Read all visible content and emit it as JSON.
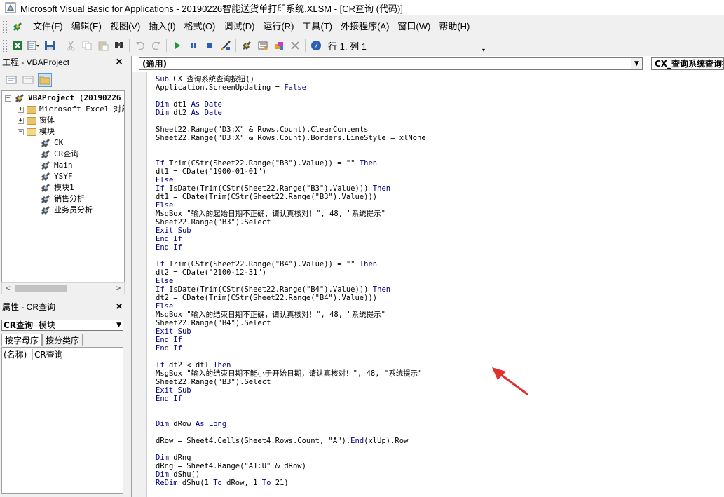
{
  "window": {
    "title": "Microsoft Visual Basic for Applications - 20190226智能送货单打印系统.XLSM - [CR查询 (代码)]"
  },
  "menu": {
    "items": [
      "文件(F)",
      "编辑(E)",
      "视图(V)",
      "插入(I)",
      "格式(O)",
      "调试(D)",
      "运行(R)",
      "工具(T)",
      "外接程序(A)",
      "窗口(W)",
      "帮助(H)"
    ]
  },
  "toolbar": {
    "position_text": "行 1, 列 1",
    "icons": [
      "excel-view-icon",
      "insert-module-icon",
      "save-icon",
      "cut-icon",
      "copy-icon",
      "paste-icon",
      "find-icon",
      "undo-icon",
      "redo-icon",
      "run-icon",
      "break-icon",
      "reset-icon",
      "design-mode-icon",
      "project-explorer-icon",
      "properties-icon",
      "object-browser-icon",
      "toolbox-icon",
      "help-icon"
    ]
  },
  "project_panel": {
    "title": "工程 - VBAProject",
    "close": "×",
    "tree": {
      "root": "VBAProject (20190226",
      "folders": [
        "Microsoft Excel 对象",
        "窗体",
        "模块"
      ],
      "modules": [
        "CK",
        "CR查询",
        "Main",
        "YSYF",
        "模块1",
        "销售分析",
        "业务员分析"
      ]
    }
  },
  "properties_panel": {
    "title": "属性 - CR查询",
    "close": "×",
    "object_name": "CR查询",
    "object_type": "模块",
    "tabs": [
      "按字母序",
      "按分类序"
    ],
    "rows": [
      {
        "name": "(名称)",
        "value": "CR查询"
      }
    ]
  },
  "code_window": {
    "object_combo": "(通用)",
    "proc_combo": "CX_查询系统查询按钮",
    "lines": [
      "Sub CX_查询系统查询按钮()",
      "Application.ScreenUpdating = False",
      "",
      "Dim dt1 As Date",
      "Dim dt2 As Date",
      "",
      "Sheet22.Range(\"D3:X\" & Rows.Count).ClearContents",
      "Sheet22.Range(\"D3:X\" & Rows.Count).Borders.LineStyle = xlNone",
      "",
      "",
      "If Trim(CStr(Sheet22.Range(\"B3\").Value)) = \"\" Then",
      "dt1 = CDate(\"1900-01-01\")",
      "Else",
      "If IsDate(Trim(CStr(Sheet22.Range(\"B3\").Value))) Then",
      "dt1 = CDate(Trim(CStr(Sheet22.Range(\"B3\").Value)))",
      "Else",
      "MsgBox \"输入的起始日期不正确，请认真核对！\", 48, \"系统提示\"",
      "Sheet22.Range(\"B3\").Select",
      "Exit Sub",
      "End If",
      "End If",
      "",
      "If Trim(CStr(Sheet22.Range(\"B4\").Value)) = \"\" Then",
      "dt2 = CDate(\"2100-12-31\")",
      "Else",
      "If IsDate(Trim(CStr(Sheet22.Range(\"B4\").Value))) Then",
      "dt2 = CDate(Trim(CStr(Sheet22.Range(\"B4\").Value)))",
      "Else",
      "MsgBox \"输入的结束日期不正确，请认真核对！\", 48, \"系统提示\"",
      "Sheet22.Range(\"B4\").Select",
      "Exit Sub",
      "End If",
      "End If",
      "",
      "If dt2 < dt1 Then",
      "MsgBox \"输入的结束日期不能小于开始日期，请认真核对！\", 48, \"系统提示\"",
      "Sheet22.Range(\"B3\").Select",
      "Exit Sub",
      "End If",
      "",
      "",
      "Dim dRow As Long",
      "",
      "dRow = Sheet4.Cells(Sheet4.Rows.Count, \"A\").End(xlUp).Row",
      "",
      "Dim dRng",
      "dRng = Sheet4.Range(\"A1:U\" & dRow)",
      "Dim dShu()",
      "ReDim dShu(1 To dRow, 1 To 21)"
    ]
  },
  "colors": {
    "keyword": "#00007f",
    "annotation_arrow": "#e0312d"
  }
}
